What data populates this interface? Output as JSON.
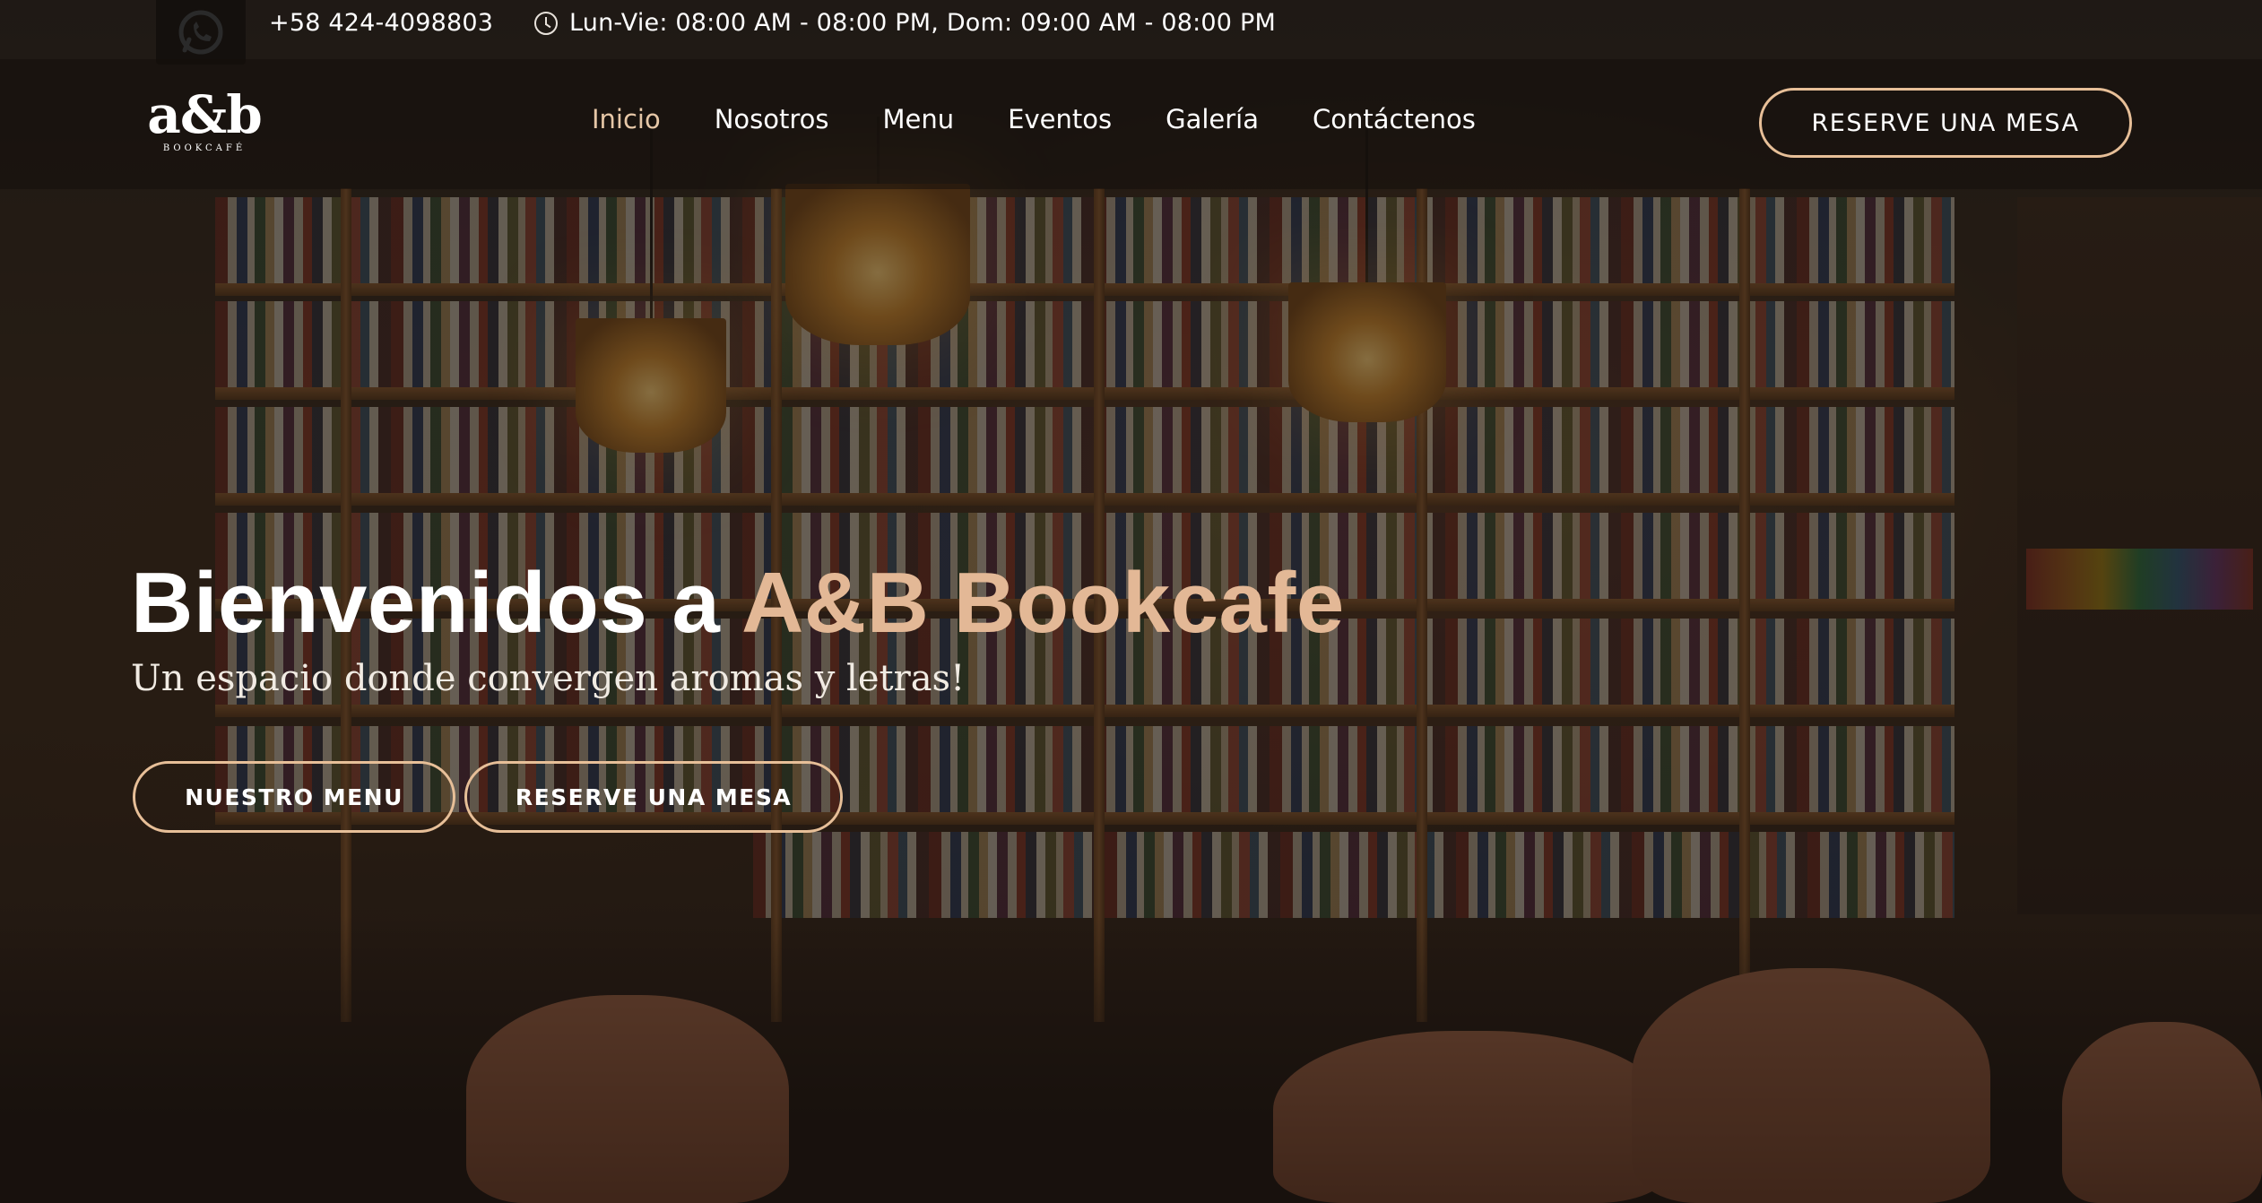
{
  "topbar": {
    "phone": "+58 424-4098803",
    "hours": "Lun-Vie: 08:00 AM - 08:00 PM, Dom: 09:00 AM - 08:00 PM",
    "whatsapp_icon": "whatsapp-icon",
    "clock_icon": "clock-icon"
  },
  "logo": {
    "main": "a&b",
    "sub": "BOOKCAFÉ"
  },
  "nav": {
    "items": [
      {
        "label": "Inicio",
        "active": true
      },
      {
        "label": "Nosotros",
        "active": false
      },
      {
        "label": "Menu",
        "active": false
      },
      {
        "label": "Eventos",
        "active": false
      },
      {
        "label": "Galería",
        "active": false
      },
      {
        "label": "Contáctenos",
        "active": false
      }
    ],
    "cta": "RESERVE UNA MESA"
  },
  "hero": {
    "title_main": "Bienvenidos a ",
    "title_accent": "A&B Bookcafe",
    "subtitle": "Un espacio donde convergen aromas y letras!",
    "button_menu": "NUESTRO MENU",
    "button_reserve": "RESERVE UNA MESA"
  },
  "colors": {
    "accent": "#e3b896",
    "button_border": "#e7bf98",
    "active_nav": "#e6c7a7"
  }
}
